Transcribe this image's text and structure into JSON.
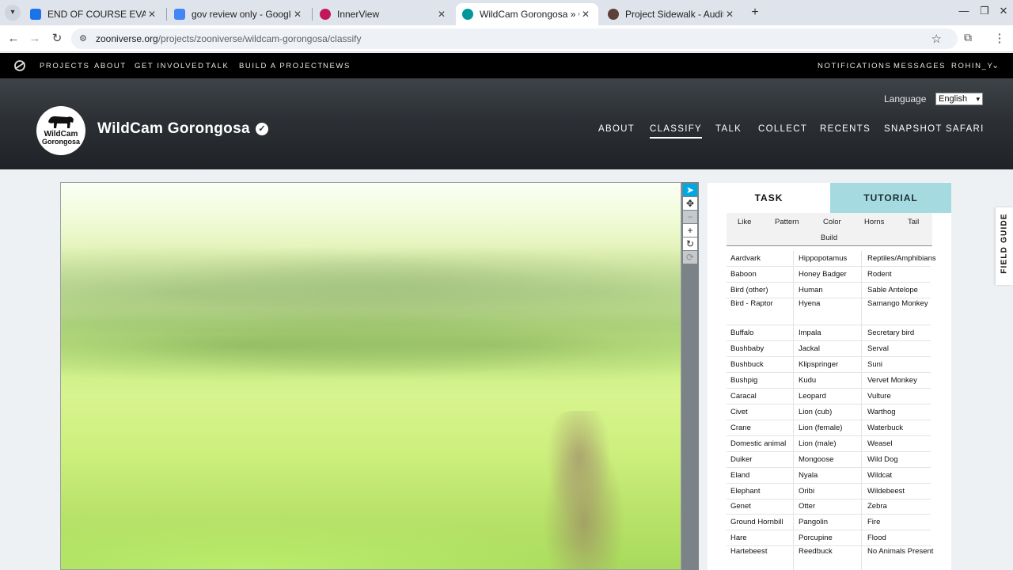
{
  "browser": {
    "tabs": [
      {
        "label": "END OF COURSE EVAL",
        "favicon_color": "#1a73e8"
      },
      {
        "label": "gov review only - Google Docs",
        "favicon_color": "#4285f4"
      },
      {
        "label": "InnerView",
        "favicon_color": "#c2185b"
      },
      {
        "label": "WildCam Gorongosa » Classify",
        "favicon_color": "#00979d"
      },
      {
        "label": "Project Sidewalk - Audit",
        "favicon_color": "#5d4037"
      }
    ],
    "url_host": "zooniverse.org",
    "url_path": "/projects/zooniverse/wildcam-gorongosa/classify"
  },
  "zooniverse_nav": {
    "left": [
      "PROJECTS",
      "ABOUT",
      "GET INVOLVED",
      "TALK",
      "BUILD A PROJECT",
      "NEWS"
    ],
    "right": [
      "NOTIFICATIONS",
      "MESSAGES",
      "ROHIN_Y"
    ]
  },
  "project": {
    "logo_line1": "WildCam",
    "logo_line2": "Gorongosa",
    "title": "WildCam Gorongosa",
    "language_label": "Language",
    "language_value": "English",
    "nav": [
      "ABOUT",
      "CLASSIFY",
      "TALK",
      "COLLECT",
      "RECENTS",
      "SNAPSHOT SAFARI"
    ],
    "active_nav": "CLASSIFY"
  },
  "panel": {
    "tab_task": "TASK",
    "tab_tutorial": "TUTORIAL",
    "filters": [
      "Like",
      "Pattern",
      "Color",
      "Horns",
      "Tail",
      "Build"
    ],
    "species_col1": [
      "Aardvark",
      "Baboon",
      "Bird (other)",
      "Bird - Raptor",
      "Buffalo",
      "Bushbaby",
      "Bushbuck",
      "Bushpig",
      "Caracal",
      "Civet",
      "Crane",
      "Domestic animal",
      "Duiker",
      "Eland",
      "Elephant",
      "Genet",
      "Ground Hornbill",
      "Hare",
      "Hartebeest"
    ],
    "species_col2": [
      "Hippopotamus",
      "Honey Badger",
      "Human",
      "Hyena",
      "Impala",
      "Jackal",
      "Klipspringer",
      "Kudu",
      "Leopard",
      "Lion (cub)",
      "Lion (female)",
      "Lion (male)",
      "Mongoose",
      "Nyala",
      "Oribi",
      "Otter",
      "Pangolin",
      "Porcupine",
      "Reedbuck"
    ],
    "species_col3": [
      "Reptiles/Amphibians",
      "Rodent",
      "Sable Antelope",
      "Samango Monkey",
      "Secretary bird",
      "Serval",
      "Suni",
      "Vervet Monkey",
      "Vulture",
      "Warthog",
      "Waterbuck",
      "Weasel",
      "Wild Dog",
      "Wildcat",
      "Wildebeest",
      "Zebra",
      "Fire",
      "Flood",
      "No Animals Present"
    ]
  },
  "field_guide_label": "FIELD GUIDE",
  "colors": {
    "tutorial_tab": "#a5dbe0",
    "active_tool": "#00a7e1"
  }
}
